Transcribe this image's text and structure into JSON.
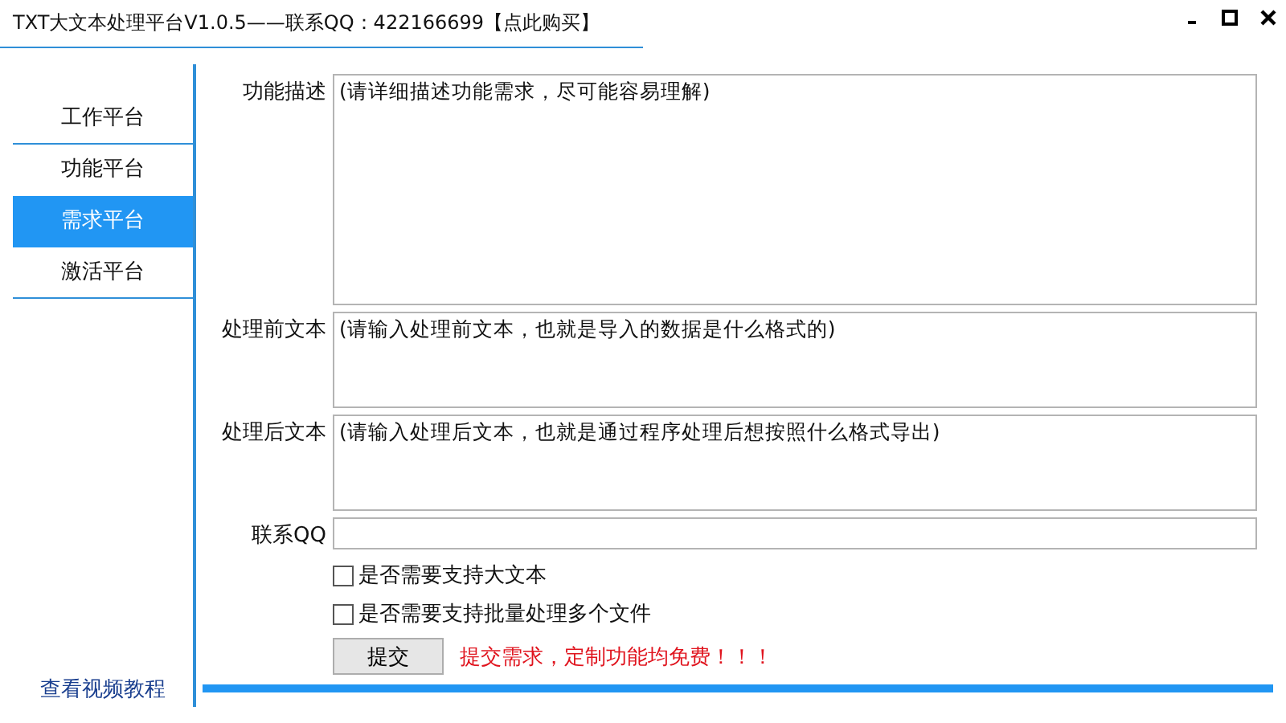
{
  "window": {
    "title": "TXT大文本处理平台V1.0.5——联系QQ：422166699【点此购买】"
  },
  "sidebar": {
    "items": [
      {
        "label": "工作平台",
        "selected": false
      },
      {
        "label": "功能平台",
        "selected": false
      },
      {
        "label": "需求平台",
        "selected": true
      },
      {
        "label": "激活平台",
        "selected": false
      }
    ],
    "footer_link": "查看视频教程"
  },
  "form": {
    "fields": [
      {
        "label": "功能描述",
        "value": "(请详细描述功能需求，尽可能容易理解)",
        "kind": "large"
      },
      {
        "label": "处理前文本",
        "value": "(请输入处理前文本，也就是导入的数据是什么格式的)",
        "kind": "medium"
      },
      {
        "label": "处理后文本",
        "value": "(请输入处理后文本，也就是通过程序处理后想按照什么格式导出)",
        "kind": "medium"
      },
      {
        "label": "联系QQ",
        "kind": "line"
      }
    ],
    "checkboxes": [
      {
        "label": "是否需要支持大文本",
        "checked": false
      },
      {
        "label": "是否需要支持批量处理多个文件",
        "checked": false
      }
    ],
    "submit_button": "提交",
    "notice": "提交需求，定制功能均免费！！！"
  }
}
